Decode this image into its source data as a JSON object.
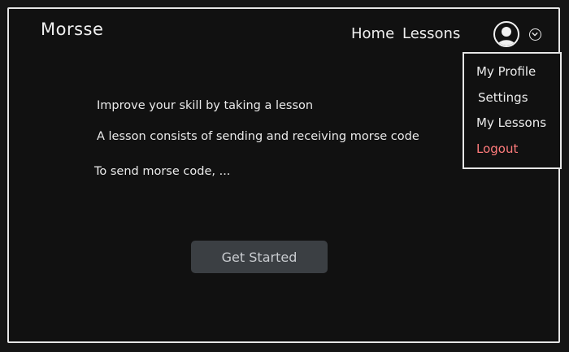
{
  "header": {
    "brand": "Morsse",
    "nav": {
      "home": "Home",
      "lessons": "Lessons"
    },
    "avatar_icon": "user-avatar-icon",
    "menu_toggle_icon": "chevron-down-icon"
  },
  "dropdown": {
    "items": [
      {
        "label": "My Profile"
      },
      {
        "label": "Settings"
      },
      {
        "label": "My Lessons"
      },
      {
        "label": "Logout",
        "color": "#ff7b7b"
      }
    ]
  },
  "content": {
    "lines": [
      "Improve your skill by taking a lesson",
      "A lesson consists of sending and receiving morse code",
      "To send morse code, ..."
    ],
    "cta_label": "Get Started"
  },
  "colors": {
    "background": "#111111",
    "border": "#e6e6e6",
    "text": "#ececec",
    "danger": "#ff7b7b",
    "button_bg": "#3b3f43",
    "button_text": "#c9ccd0"
  }
}
